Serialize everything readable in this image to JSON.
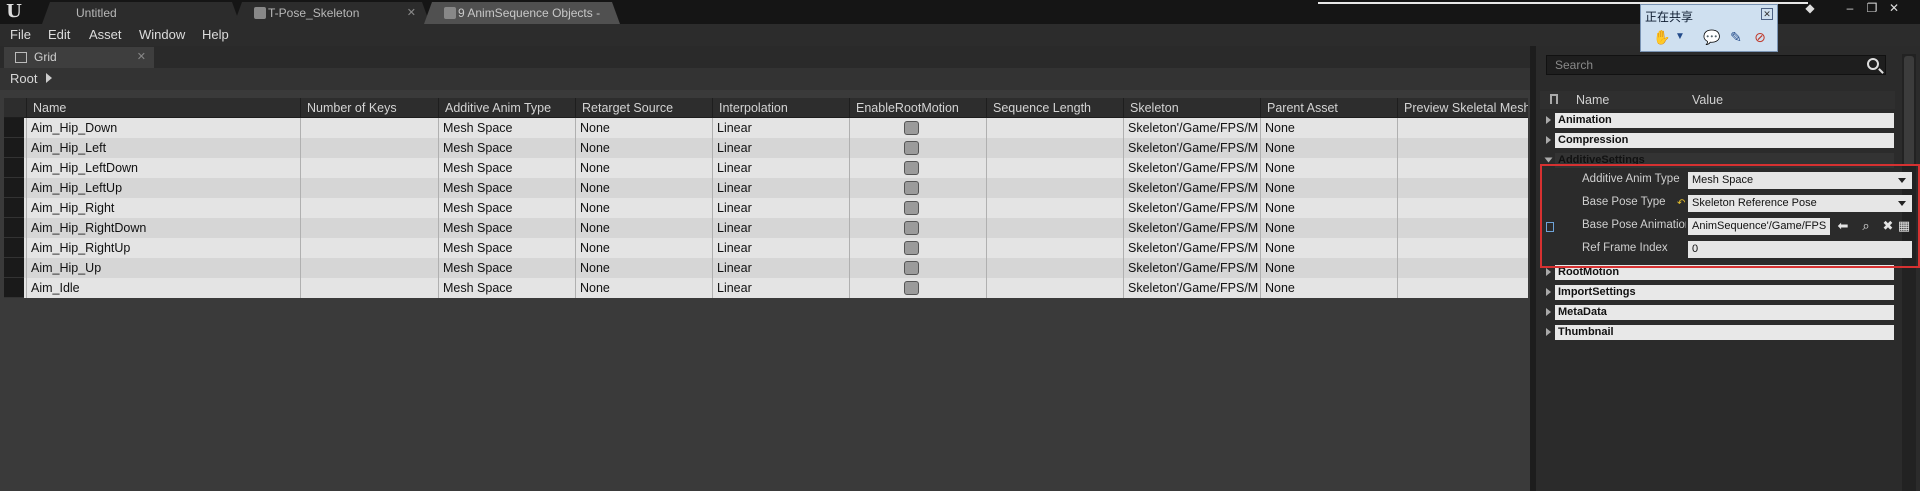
{
  "tabs": [
    {
      "label": "Untitled"
    },
    {
      "label": "T-Pose_Skeleton"
    },
    {
      "label": "9 AnimSequence Objects -"
    }
  ],
  "menu": [
    "File",
    "Edit",
    "Asset",
    "Window",
    "Help"
  ],
  "grid_tab": {
    "label": "Grid"
  },
  "breadcrumb": {
    "root": "Root"
  },
  "columns": [
    "Name",
    "Number of Keys",
    "Additive Anim Type",
    "Retarget Source",
    "Interpolation",
    "EnableRootMotion",
    "Sequence Length",
    "Skeleton",
    "Parent Asset",
    "Preview Skeletal Mesh"
  ],
  "rows": [
    {
      "name": "Aim_Hip_Down",
      "keys": "",
      "additive": "Mesh Space",
      "retarget": "None",
      "interp": "Linear",
      "length": "",
      "skeleton": "Skeleton'/Game/FPS/M",
      "parent": "None",
      "preview": ""
    },
    {
      "name": "Aim_Hip_Left",
      "keys": "",
      "additive": "Mesh Space",
      "retarget": "None",
      "interp": "Linear",
      "length": "",
      "skeleton": "Skeleton'/Game/FPS/M",
      "parent": "None",
      "preview": ""
    },
    {
      "name": "Aim_Hip_LeftDown",
      "keys": "",
      "additive": "Mesh Space",
      "retarget": "None",
      "interp": "Linear",
      "length": "",
      "skeleton": "Skeleton'/Game/FPS/M",
      "parent": "None",
      "preview": ""
    },
    {
      "name": "Aim_Hip_LeftUp",
      "keys": "",
      "additive": "Mesh Space",
      "retarget": "None",
      "interp": "Linear",
      "length": "",
      "skeleton": "Skeleton'/Game/FPS/M",
      "parent": "None",
      "preview": ""
    },
    {
      "name": "Aim_Hip_Right",
      "keys": "",
      "additive": "Mesh Space",
      "retarget": "None",
      "interp": "Linear",
      "length": "",
      "skeleton": "Skeleton'/Game/FPS/M",
      "parent": "None",
      "preview": ""
    },
    {
      "name": "Aim_Hip_RightDown",
      "keys": "",
      "additive": "Mesh Space",
      "retarget": "None",
      "interp": "Linear",
      "length": "",
      "skeleton": "Skeleton'/Game/FPS/M",
      "parent": "None",
      "preview": ""
    },
    {
      "name": "Aim_Hip_RightUp",
      "keys": "",
      "additive": "Mesh Space",
      "retarget": "None",
      "interp": "Linear",
      "length": "",
      "skeleton": "Skeleton'/Game/FPS/M",
      "parent": "None",
      "preview": ""
    },
    {
      "name": "Aim_Hip_Up",
      "keys": "",
      "additive": "Mesh Space",
      "retarget": "None",
      "interp": "Linear",
      "length": "",
      "skeleton": "Skeleton'/Game/FPS/M",
      "parent": "None",
      "preview": ""
    },
    {
      "name": "Aim_Idle",
      "keys": "",
      "additive": "Mesh Space",
      "retarget": "None",
      "interp": "Linear",
      "length": "",
      "skeleton": "Skeleton'/Game/FPS/M",
      "parent": "None",
      "preview": ""
    }
  ],
  "details": {
    "search_placeholder": "Search",
    "header_name": "Name",
    "header_value": "Value",
    "categories": [
      "Animation",
      "Compression",
      "AdditiveSettings",
      "RootMotion",
      "ImportSettings",
      "MetaData",
      "Thumbnail"
    ],
    "additive_anim_type": {
      "label": "Additive Anim Type",
      "value": "Mesh Space"
    },
    "base_pose_type": {
      "label": "Base Pose Type",
      "value": "Skeleton Reference Pose"
    },
    "base_pose_animation": {
      "label": "Base Pose Animation",
      "value": "AnimSequence'/Game/FPS"
    },
    "ref_frame_index": {
      "label": "Ref Frame Index",
      "value": "0"
    }
  },
  "share_popup": {
    "title": "正在共享"
  },
  "colors": {
    "highlight": "#d63131",
    "row_odd": "#e4e4e4",
    "row_even": "#d6d6d6"
  }
}
